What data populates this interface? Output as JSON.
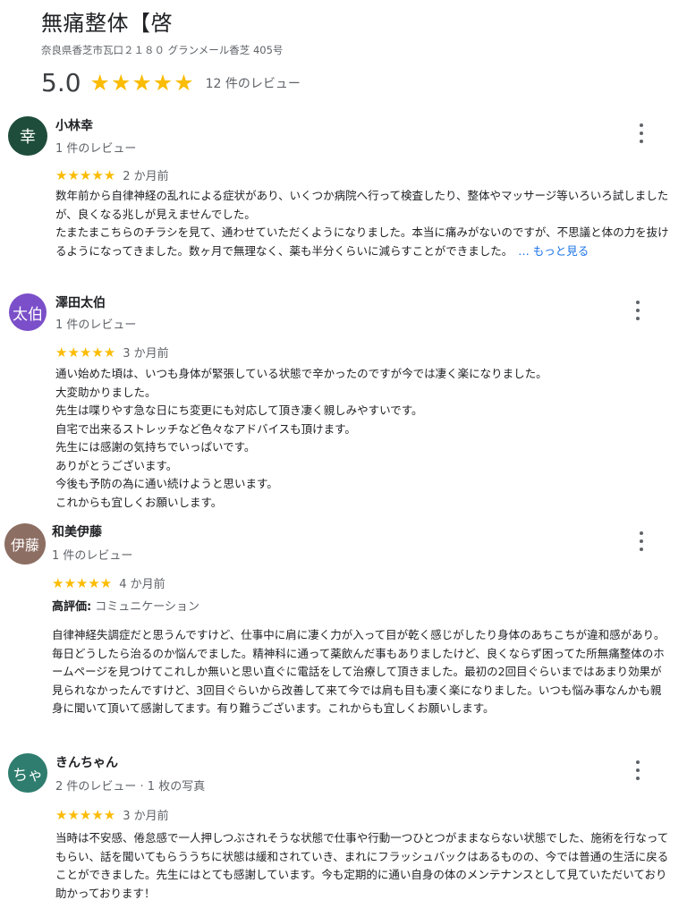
{
  "business": {
    "name": "無痛整体【啓",
    "address": "奈良県香芝市瓦口２１８０ グランメール香芝 405号",
    "rating": "5.0",
    "review_count": "12 件のレビュー",
    "star_icon": "star-icon",
    "star_color": "#fbbc04"
  },
  "reviews": [
    {
      "avatar_text": "幸",
      "avatar_color": "#1e4d3b",
      "name": "小林幸",
      "meta": "1 件のレビュー",
      "time": "2 か月前",
      "rating": 5,
      "lines": [
        "数年前から自律神経の乱れによる症状があり、いくつか病院へ行って検査したり、整体やマッサージ等いろいろ試しましたが、良くなる兆しが見えませんでした。",
        "たまたまこちらのチラシを見て、通わせていただくようになりました。本当に痛みがないのですが、不思議と体の力を抜けるようになってきました。数ヶ月で無理なく、薬も半分くらいに減らすことができました。"
      ],
      "more_link": "… もっと見る"
    },
    {
      "avatar_text": "太伯",
      "avatar_color": "#7b4fc9",
      "name": "澤田太伯",
      "meta": "1 件のレビュー",
      "time": "3 か月前",
      "rating": 5,
      "lines": [
        "通い始めた頃は、いつも身体が緊張している状態で辛かったのですが今では凄く楽になりました。",
        "大変助かりました。",
        "先生は喋りやす急な日にち変更にも対応して頂き凄く親しみやすいです。",
        "自宅で出来るストレッチなど色々なアドバイスも頂けます。",
        "先生には感謝の気持ちでいっぱいです。",
        "ありがとうございます。",
        "今後も予防の為に通い続けようと思います。",
        "これからも宜しくお願いします。"
      ]
    },
    {
      "avatar_text": "伊藤",
      "avatar_color": "#8d6e63",
      "name": "和美伊藤",
      "meta": "1 件のレビュー",
      "time": "4 か月前",
      "rating": 5,
      "highlight_label": "高評価:",
      "highlight_value": "コミュニケーション",
      "lines": [
        "自律神経失調症だと思うんですけど、仕事中に肩に凄く力が入って目が乾く感じがしたり身体のあちこちが違和感があり。毎日どうしたら治るのか悩んでました。精神科に通って薬飲んだ事もありましたけど、良くならず困ってた所無痛整体のホームページを見つけてこれしか無いと思い直ぐに電話をして治療して頂きました。最初の2回目ぐらいまではあまり効果が見られなかったんですけど、3回目ぐらいから改善して来て今では肩も目も凄く楽になりました。いつも悩み事なんかも親身に聞いて頂いて感謝してます。有り難うございます。これからも宜しくお願いします。"
      ]
    },
    {
      "avatar_text": "ちゃ",
      "avatar_color": "#2e7d6e",
      "name": "きんちゃん",
      "meta": "2 件のレビュー · 1 枚の写真",
      "time": "3 か月前",
      "rating": 5,
      "lines": [
        "当時は不安感、倦怠感で一人押しつぶされそうな状態で仕事や行動一つひとつがままならない状態でした、施術を行なってもらい、話を聞いてもらううちに状態は緩和されていき、まれにフラッシュバックはあるものの、今では普通の生活に戻ることができました。先生にはとても感謝しています。今も定期的に通い自身の体のメンテナンスとして見ていただいており助かっております！"
      ]
    }
  ]
}
